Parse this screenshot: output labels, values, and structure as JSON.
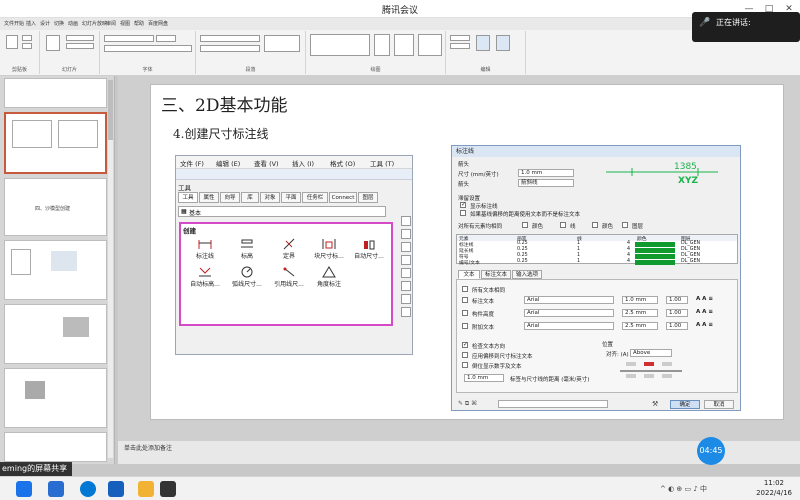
{
  "meeting": {
    "title": "腾讯会议",
    "speaking_label": "正在讲话:",
    "timer": "04:45",
    "share_label": "eming的屏幕共享"
  },
  "ribbon": {
    "tabs": [
      "文件",
      "开始",
      "插入",
      "设计",
      "切换",
      "动画",
      "幻灯片放映",
      "审阅",
      "视图",
      "帮助",
      "百度网盘"
    ],
    "groups": [
      "剪贴板",
      "幻灯片",
      "字体",
      "段落",
      "绘图",
      "编辑"
    ]
  },
  "slides_panel": {
    "thumb_caption": "四、沙模型创建"
  },
  "slide": {
    "title": "三、2D基本功能",
    "subtitle": "4.创建尺寸标注线"
  },
  "acad": {
    "menu": [
      "文件 (F)",
      "编辑 (E)",
      "查看 (V)",
      "插入 (I)",
      "格式 (O)",
      "工具 (T)"
    ],
    "tools_title": "工具",
    "tabs": [
      "工具",
      "属性",
      "向导",
      "库",
      "对象",
      "平面",
      "任务栏",
      "Connect",
      "图层"
    ],
    "combo": "基本",
    "create_label": "创建",
    "tools": [
      "标注线",
      "标高",
      "定界",
      "块尺寸标...",
      "自动尺寸...",
      "自动标高...",
      "弧线尺寸...",
      "引用线尺...",
      "角度标注"
    ]
  },
  "dialog": {
    "title": "标注线",
    "section_arrow": "箭头",
    "size_label": "尺寸 (mm/英寸)",
    "size_value": "1.0 mm",
    "arrow_label": "箭头",
    "arrow_value": "箭斜线",
    "preview_value": "1385",
    "preview_text": "XYZ",
    "ext_label": "滞留设置",
    "chk_show_ext": "显示标注线",
    "chk_ext_2": "如果基线偏移的距离使用文本而不是标注文本",
    "table_label": "对所有元素均相同",
    "table_opts": [
      "颜色",
      "线",
      "颜色",
      "图层"
    ],
    "header": [
      "元素",
      "画笔",
      "线",
      "颜色",
      "图层"
    ],
    "rows": [
      {
        "name": "标注线",
        "pen": "0.25",
        "line": "1",
        "color": "4",
        "layer": "DL_GEN"
      },
      {
        "name": "延长线",
        "pen": "0.25",
        "line": "1",
        "color": "4",
        "layer": "DL_GEN"
      },
      {
        "name": "符号",
        "pen": "0.25",
        "line": "1",
        "color": "4",
        "layer": "DL_GEN"
      },
      {
        "name": "编号/文本",
        "pen": "0.25",
        "line": "1",
        "color": "4",
        "layer": "DL_GEN"
      }
    ],
    "tabs": [
      "文本",
      "标注文本",
      "输入选项"
    ],
    "chk_all": "所有文本相同",
    "text_rows": [
      {
        "label": "标注文本",
        "font": "Arial",
        "size": "1.0 mm",
        "scale": "1.00"
      },
      {
        "label": "构件高度",
        "font": "Arial",
        "size": "2.5 mm",
        "scale": "1.00"
      },
      {
        "label": "附加文本",
        "font": "Arial",
        "size": "2.5 mm",
        "scale": "1.00"
      }
    ],
    "chk_a": "检查文本方向",
    "chk_b": "应用偏移到尺寸标注文本",
    "chk_c": "倒位显示数字及文本",
    "distance_value": "1.0 mm",
    "distance_label": "标签与尺寸线的距离 (毫米/英寸)",
    "position_label": "位置",
    "align_label": "对齐: (A)",
    "align_value": "Above",
    "ok": "确定",
    "cancel": "取消"
  },
  "status": {
    "text": "单击此处添加备注"
  },
  "clock": {
    "time": "11:02",
    "date": "2022/4/16"
  }
}
